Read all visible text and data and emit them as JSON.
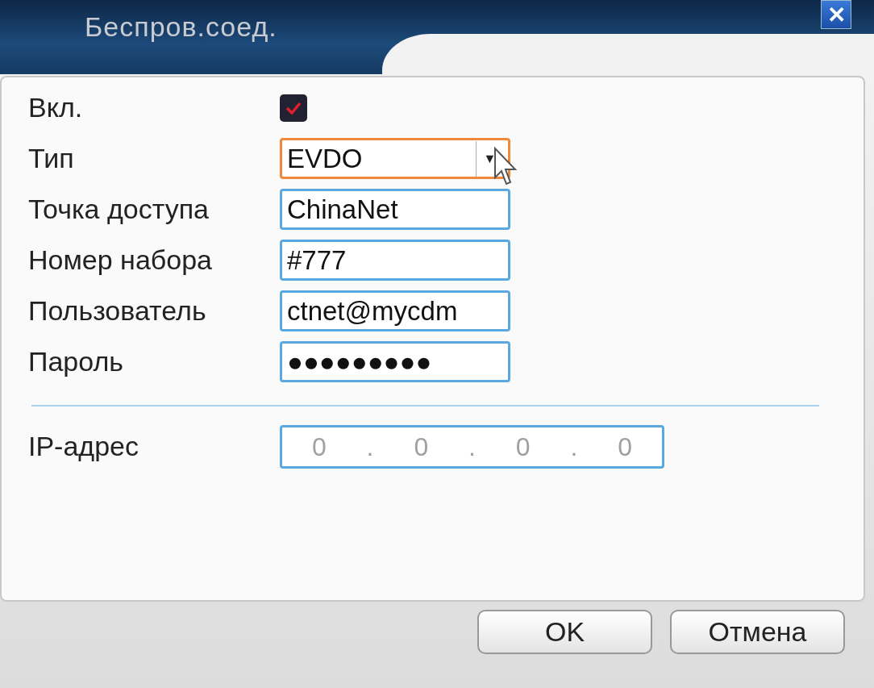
{
  "window": {
    "title": "Беспров.соед.",
    "close": "✕"
  },
  "fields": [
    {
      "kind": "checkbox",
      "label": "Вкл.",
      "checked": true
    },
    {
      "kind": "select",
      "label": "Тип",
      "value": "EVDO",
      "focused": true,
      "arrow": "▼"
    },
    {
      "kind": "text",
      "label": "Точка доступа",
      "value": "ChinaNet"
    },
    {
      "kind": "text",
      "label": "Номер набора",
      "value": "#777"
    },
    {
      "kind": "text",
      "label": "Пользователь",
      "value": "ctnet@mycdm"
    },
    {
      "kind": "text",
      "label": "Пароль",
      "value": "●●●●●●●●●"
    }
  ],
  "ip_address": {
    "label": "IP-адрес",
    "disabled": true,
    "parts": [
      "0",
      ".",
      "0",
      ".",
      "0",
      ".",
      "0"
    ]
  },
  "buttons": [
    "OK",
    "Отмена"
  ]
}
